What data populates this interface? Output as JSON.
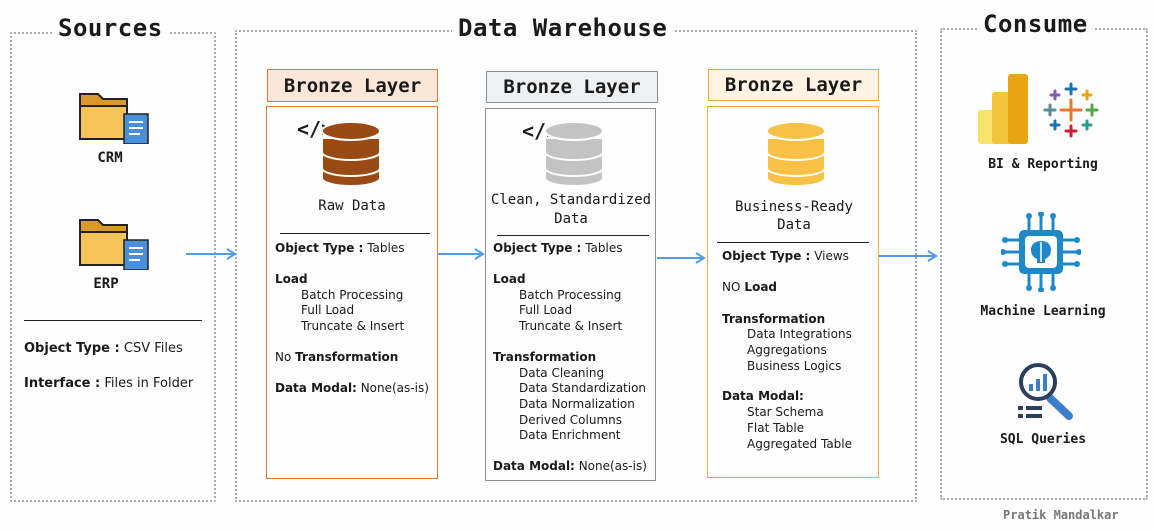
{
  "sections": {
    "sources": "Sources",
    "warehouse": "Data Warehouse",
    "consume": "Consume"
  },
  "sources": {
    "items": [
      "CRM",
      "ERP"
    ],
    "object_type_label": "Object Type :",
    "object_type_value": "CSV Files",
    "interface_label": "Interface :",
    "interface_value": "Files in Folder"
  },
  "layers": [
    {
      "title": "Bronze Layer",
      "caption": "Raw Data",
      "object_type_label": "Object Type :",
      "object_type_value": "Tables",
      "load_heading": "Load",
      "load_items": [
        "Batch Processing",
        "Full Load",
        "Truncate & Insert"
      ],
      "transformation_prefix": "No",
      "transformation_heading": "Transformation",
      "modal_label": "Data Modal:",
      "modal_value": "None(as-is)",
      "colors": {
        "title_bg": "#fbe6d8",
        "title_border": "#e07a38",
        "box_border": "#e07a38",
        "db": "#9a4a14"
      }
    },
    {
      "title": "Bronze Layer",
      "caption_1": "Clean, Standardized",
      "caption_2": "Data",
      "object_type_label": "Object Type :",
      "object_type_value": "Tables",
      "load_heading": "Load",
      "load_items": [
        "Batch Processing",
        "Full Load",
        "Truncate & Insert"
      ],
      "transformation_heading": "Transformation",
      "transformation_items": [
        "Data Cleaning",
        "Data Standardization",
        "Data Normalization",
        "Derived Columns",
        "Data Enrichment"
      ],
      "modal_label": "Data Modal:",
      "modal_value": "None(as-is)",
      "colors": {
        "title_bg": "#eef0f2",
        "title_border": "#8c9196",
        "box_border": "#8c9196",
        "db": "#c3c3c3"
      }
    },
    {
      "title": "Bronze Layer",
      "caption_1": "Business-Ready",
      "caption_2": "Data",
      "object_type_label": "Object Type :",
      "object_type_value": "Views",
      "load_prefix": "NO",
      "load_heading": "Load",
      "transformation_heading": "Transformation",
      "transformation_items": [
        "Data Integrations",
        "Aggregations",
        "Business Logics"
      ],
      "modal_label": "Data Modal:",
      "modal_items": [
        "Star Schema",
        "Flat Table",
        "Aggregated Table"
      ],
      "colors": {
        "title_bg": "#fff4e3",
        "title_border": "#f2a93b",
        "box_border": "#f2a93b",
        "db": "#f8c044"
      }
    }
  ],
  "code_glyph": "</>",
  "consume": {
    "items": [
      "BI & Reporting",
      "Machine Learning",
      "SQL Queries"
    ]
  },
  "author": "Pratik Mandalkar",
  "icons": [
    "folder-icon",
    "database-icon",
    "code-icon",
    "power-bi-icon",
    "tableau-icon",
    "ai-chip-icon",
    "search-chart-icon"
  ],
  "colors": {
    "arrow": "#4f9ee6",
    "folder": "#f6c35a",
    "doc": "#4a8fd9"
  }
}
